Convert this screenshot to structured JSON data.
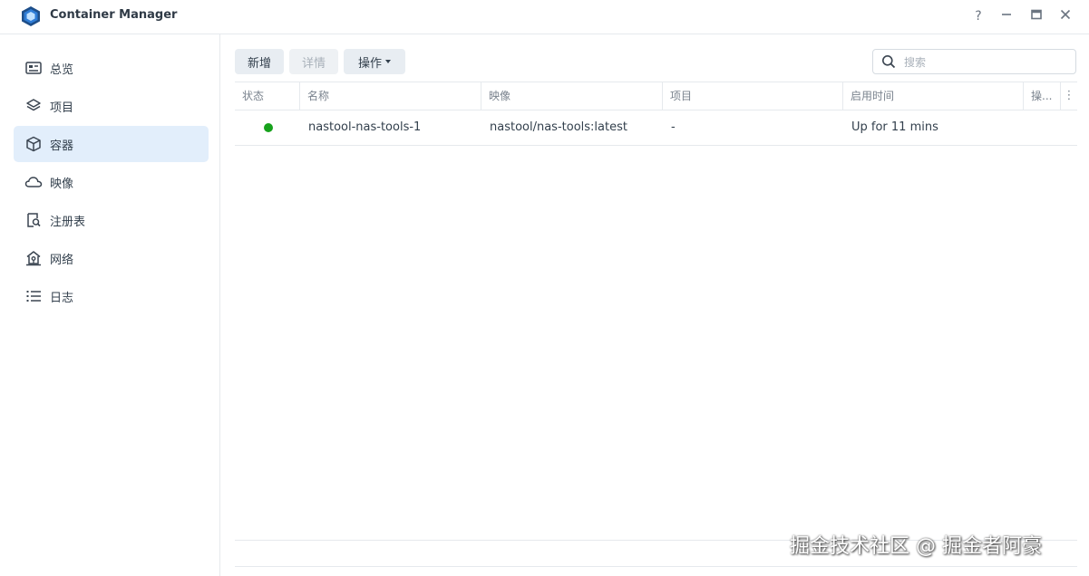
{
  "app": {
    "title": "Container Manager"
  },
  "window_controls": {
    "help": "?",
    "minimize": "–",
    "maximize": "▭",
    "close": "✕"
  },
  "sidebar": {
    "items": [
      {
        "label": "总览",
        "icon": "overview-icon",
        "active": false
      },
      {
        "label": "项目",
        "icon": "layers-icon",
        "active": false
      },
      {
        "label": "容器",
        "icon": "cube-icon",
        "active": true
      },
      {
        "label": "映像",
        "icon": "cloud-icon",
        "active": false
      },
      {
        "label": "注册表",
        "icon": "registry-search-icon",
        "active": false
      },
      {
        "label": "网络",
        "icon": "network-home-icon",
        "active": false
      },
      {
        "label": "日志",
        "icon": "list-icon",
        "active": false
      }
    ]
  },
  "toolbar": {
    "add_label": "新增",
    "detail_label": "详情",
    "action_label": "操作"
  },
  "search": {
    "placeholder": "搜索",
    "value": ""
  },
  "table": {
    "columns": [
      "状态",
      "名称",
      "映像",
      "项目",
      "启用时间",
      "操..."
    ],
    "rows": [
      {
        "status": "running",
        "name": "nastool-nas-tools-1",
        "image": "nastool/nas-tools:latest",
        "project": "-",
        "uptime": "Up for 11 mins"
      }
    ]
  },
  "colors": {
    "accent": "#1e5fa8",
    "status_running": "#17a21c",
    "active_nav": "#e2eefb"
  },
  "watermark": "掘金技术社区 @ 掘金者阿豪"
}
